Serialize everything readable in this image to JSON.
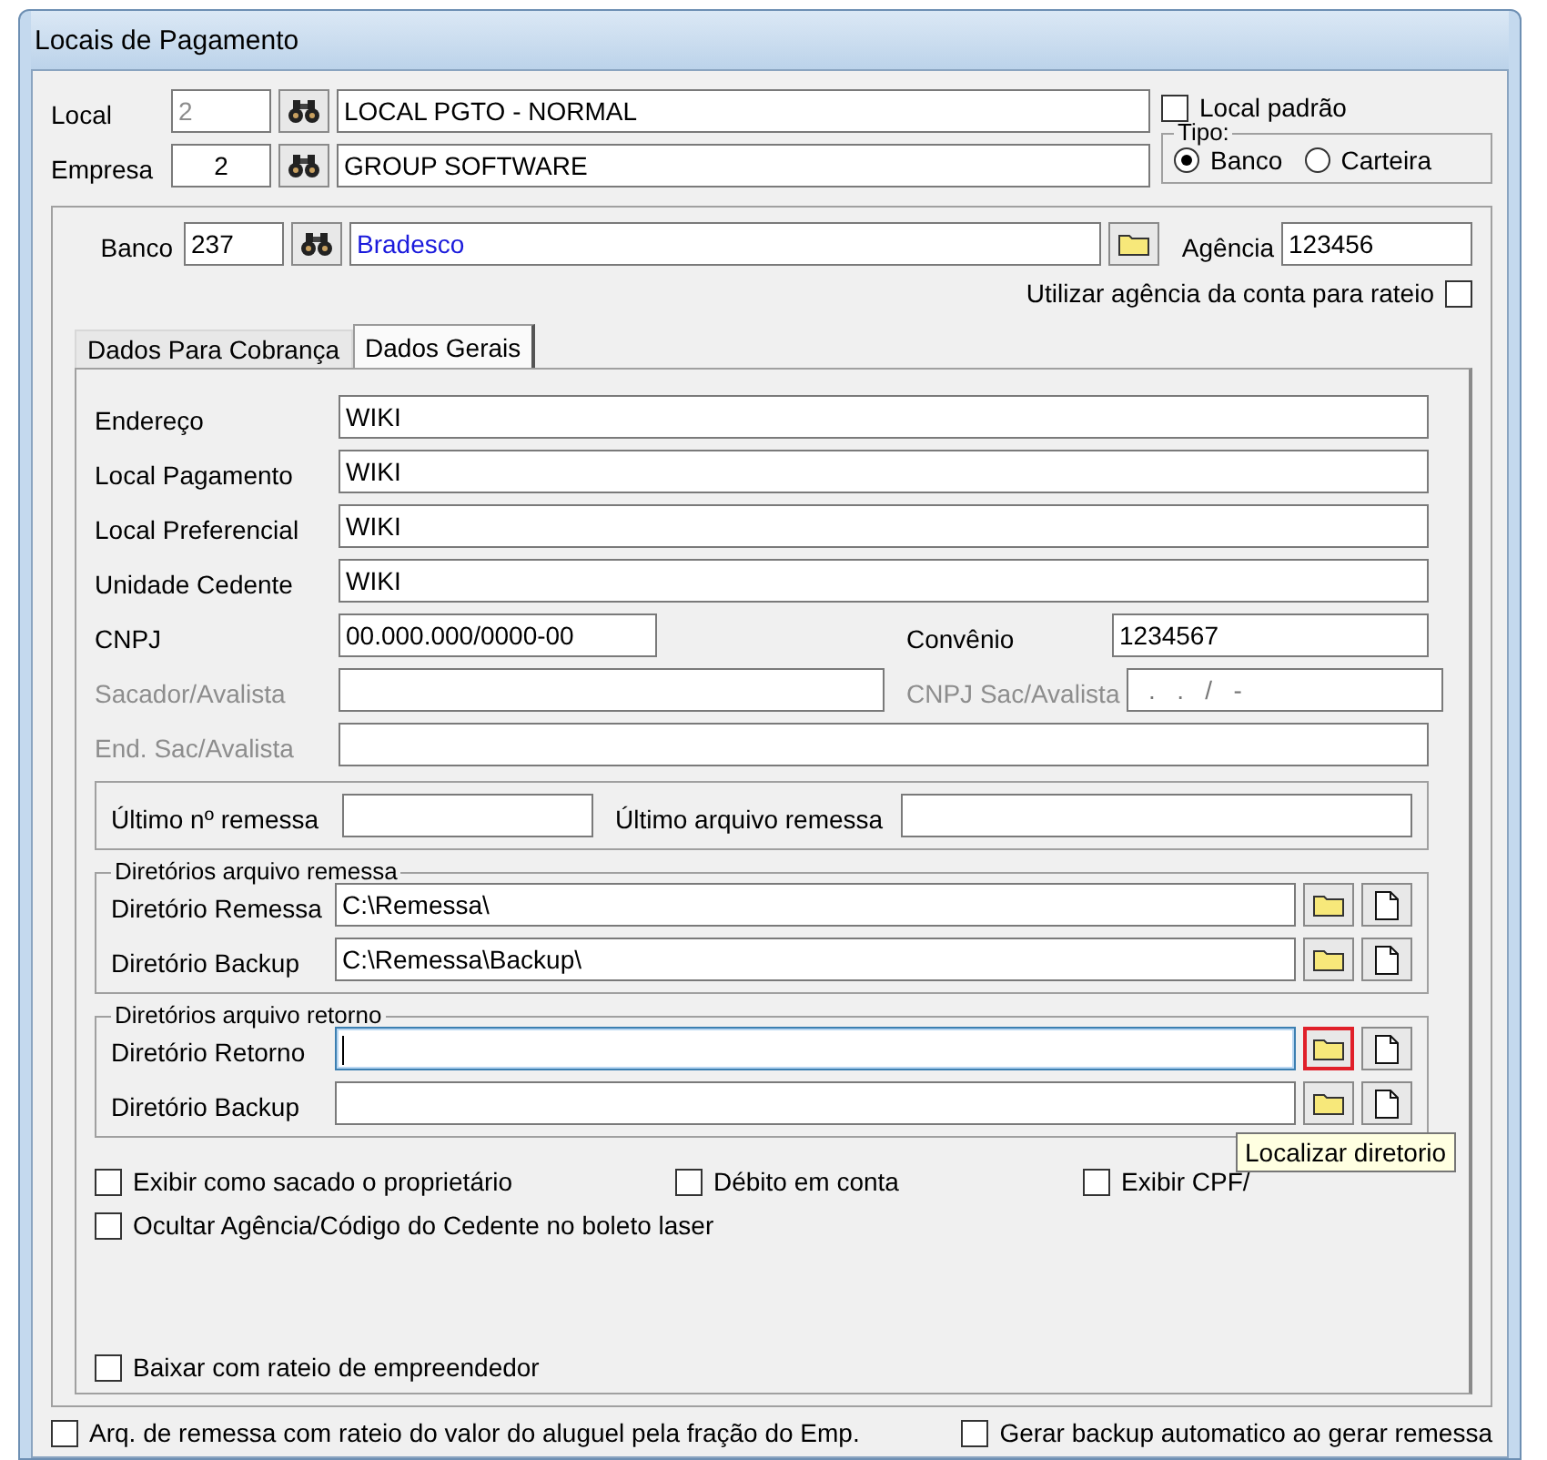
{
  "window": {
    "title": "Locais de Pagamento"
  },
  "header": {
    "rows": [
      {
        "label": "Local",
        "code": "2",
        "code_disabled": true,
        "name": "LOCAL PGTO - NORMAL"
      },
      {
        "label": "Empresa",
        "code": "2",
        "code_disabled": false,
        "name": "GROUP SOFTWARE"
      }
    ],
    "default_option": {
      "label": "Local padrão",
      "checked": false
    },
    "type_group": {
      "title": "Tipo:",
      "options": [
        {
          "label": "Banco",
          "selected": true
        },
        {
          "label": "Carteira",
          "selected": false
        }
      ]
    }
  },
  "bank": {
    "label": "Banco",
    "code": "237",
    "name": "Bradesco",
    "agency_label": "Agência",
    "agency": "123456",
    "agency_option": {
      "label": "Utilizar agência da conta para rateio",
      "checked": false
    }
  },
  "tabs": [
    {
      "label": "Dados Para Cobrança",
      "selected": false
    },
    {
      "label": "Dados Gerais",
      "selected": true
    }
  ],
  "fields": [
    {
      "kind": "full",
      "label": "Endereço",
      "value": "WIKI",
      "disabled": false
    },
    {
      "kind": "full",
      "label": "Local Pagamento",
      "value": "WIKI",
      "disabled": false
    },
    {
      "kind": "full",
      "label": "Local Preferencial",
      "value": "WIKI",
      "disabled": false
    },
    {
      "kind": "full",
      "label": "Unidade Cedente",
      "value": "WIKI",
      "disabled": false
    },
    {
      "kind": "pair-narrow",
      "label": "CNPJ",
      "value": "00.000.000/0000-00",
      "right_label": "Convênio",
      "right_value": "1234567",
      "disabled": false
    },
    {
      "kind": "pair-wide",
      "label": "Sacador/Avalista",
      "right_label": "CNPJ Sac/Avalista",
      "right_value": "  .   .   /   -",
      "disabled": true
    },
    {
      "kind": "full",
      "label": "End. Sac/Avalista",
      "disabled": true
    }
  ],
  "remittance": {
    "last_number_label": "Último nº remessa",
    "last_file_label": "Último arquivo remessa"
  },
  "directory_groups": [
    {
      "title": "Diretórios arquivo remessa",
      "rows": [
        {
          "label": "Diretório Remessa",
          "value": "C:\\Remessa\\",
          "focused": false,
          "folder_highlighted": false
        },
        {
          "label": "Diretório Backup",
          "value": "C:\\Remessa\\Backup\\",
          "focused": false,
          "folder_highlighted": false
        }
      ]
    },
    {
      "title": "Diretórios arquivo retorno",
      "rows": [
        {
          "label": "Diretório Retorno",
          "focused": true,
          "folder_highlighted": true
        },
        {
          "label": "Diretório Backup",
          "focused": false,
          "folder_highlighted": false
        }
      ]
    }
  ],
  "tooltip": "Localizar diretorio",
  "options": {
    "rows": [
      [
        {
          "label": "Exibir como sacado o proprietário",
          "checked": false
        },
        {
          "label": "Débito em conta",
          "checked": false
        },
        {
          "label": "Exibir CPF/",
          "checked": false
        }
      ],
      [
        {
          "label": "Ocultar Agência/Código do Cedente no boleto laser",
          "checked": false
        }
      ]
    ],
    "last": {
      "label": "Baixar com rateio de empreendedor",
      "checked": false
    }
  },
  "bottom_options": [
    {
      "label": "Arq. de remessa com rateio do valor do aluguel pela fração do Emp.",
      "checked": false
    },
    {
      "label": "Gerar backup automatico ao gerar remessa",
      "checked": false
    }
  ]
}
